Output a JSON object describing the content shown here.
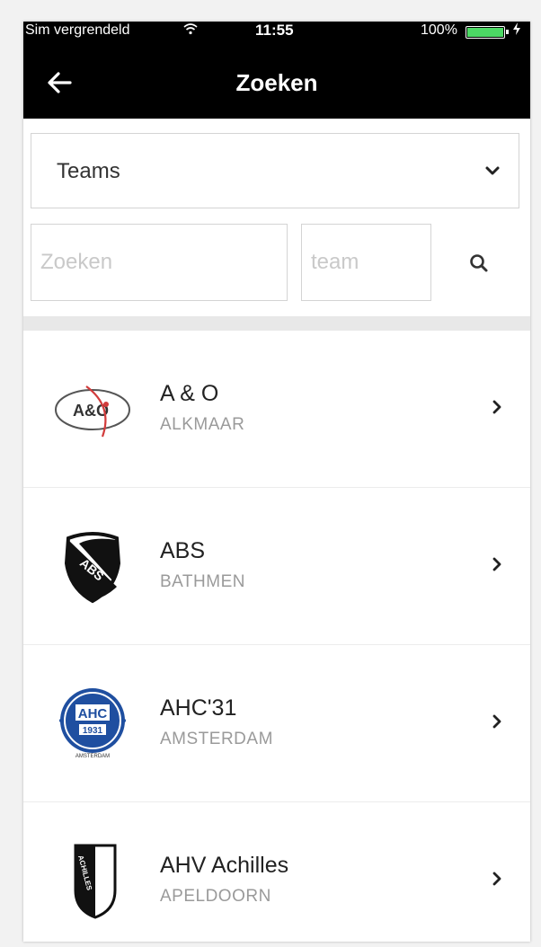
{
  "status_bar": {
    "carrier": "Sim vergrendeld",
    "time": "11:55",
    "battery": "100%"
  },
  "header": {
    "title": "Zoeken",
    "back_icon": "arrow-left-icon"
  },
  "filter": {
    "selected": "Teams",
    "icon": "chevron-down-icon"
  },
  "search": {
    "query_placeholder": "Zoeken",
    "team_placeholder": "team",
    "icon": "search-icon"
  },
  "results": [
    {
      "name": "A & O",
      "city": "ALKMAAR"
    },
    {
      "name": "ABS",
      "city": "BATHMEN"
    },
    {
      "name": "AHC'31",
      "city": "AMSTERDAM"
    },
    {
      "name": "AHV Achilles",
      "city": "APELDOORN"
    }
  ],
  "logos": {
    "ao": "A&O",
    "abs": "ABS",
    "ahc": "AHC",
    "ahc_year": "1931",
    "ahc_city": "AMSTERDAM",
    "ahv": "ACHILLES"
  },
  "colors": {
    "header_bg": "#000000",
    "battery": "#4cd964",
    "ahc_blue": "#1f4fa0",
    "ao_red": "#d23c3c"
  }
}
